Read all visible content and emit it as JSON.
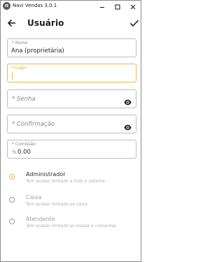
{
  "window": {
    "title": "Navi Vendas 3.0.1",
    "app_icon_letter": "n"
  },
  "appbar": {
    "title": "Usuário"
  },
  "form": {
    "nome": {
      "label": "* Nome",
      "value": "Ana (proprietária)"
    },
    "login": {
      "label": "* Login",
      "value": ""
    },
    "senha": {
      "placeholder": "* Senha"
    },
    "confirmacao": {
      "placeholder": "* Confirmação"
    },
    "comissao": {
      "label": "* Comissão",
      "prefix": "%",
      "value": "0.00"
    }
  },
  "roles": [
    {
      "title": "Administrador",
      "description": "Tem acesso limitado a todo o sistema",
      "selected": true
    },
    {
      "title": "Caixa",
      "description": "Tem acesso limitado ao caixa",
      "selected": false
    },
    {
      "title": "Atendente",
      "description": "Tem acesso limitado as mesas e comandas",
      "selected": false
    }
  ],
  "colors": {
    "accent": "#f2b544",
    "border": "#bdbdbd",
    "text": "#2a2a2a",
    "muted": "#8a8a8a"
  },
  "icons": {
    "back": "arrow-left-icon",
    "confirm": "check-icon",
    "password_visibility": "eye-icon"
  }
}
